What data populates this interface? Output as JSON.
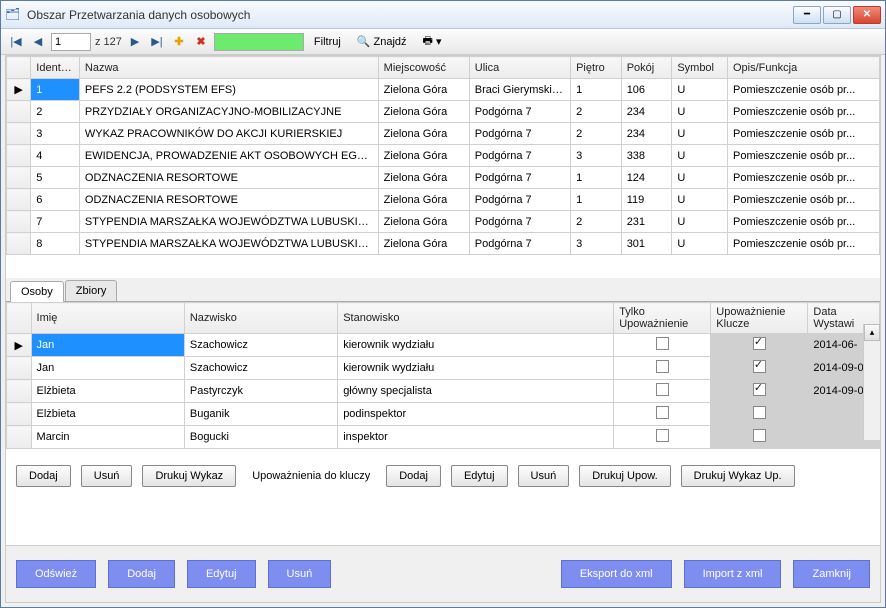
{
  "window": {
    "title": "Obszar Przetwarzania danych osobowych"
  },
  "toolbar": {
    "page_current": "1",
    "page_total": "z 127",
    "filter_label": "Filtruj",
    "find_label": "Znajdź"
  },
  "grid1": {
    "headers": {
      "ident": "Identyfik",
      "nazwa": "Nazwa",
      "miejsc": "Miejscowość",
      "ulica": "Ulica",
      "pietro": "Piętro",
      "pokoj": "Pokój",
      "symbol": "Symbol",
      "opis": "Opis/Funkcja"
    },
    "rows": [
      {
        "id": "1",
        "nazwa": "PEFS 2.2 (PODSYSTEM EFS)",
        "miejsc": "Zielona Góra",
        "ulica": "Braci Gierymskic...",
        "pietro": "1",
        "pokoj": "106",
        "symbol": "U",
        "opis": "Pomieszczenie osób pr..."
      },
      {
        "id": "2",
        "nazwa": "PRZYDZIAŁY ORGANIZACYJNO-MOBILIZACYJNE",
        "miejsc": "Zielona Góra",
        "ulica": "Podgórna 7",
        "pietro": "2",
        "pokoj": "234",
        "symbol": "U",
        "opis": "Pomieszczenie osób pr..."
      },
      {
        "id": "3",
        "nazwa": "WYKAZ PRACOWNIKÓW DO AKCJI KURIERSKIEJ",
        "miejsc": "Zielona Góra",
        "ulica": "Podgórna 7",
        "pietro": "2",
        "pokoj": "234",
        "symbol": "U",
        "opis": "Pomieszczenie osób pr..."
      },
      {
        "id": "4",
        "nazwa": "EWIDENCJA, PROWADZENIE AKT OSOBOWYCH EGZA...",
        "miejsc": "Zielona Góra",
        "ulica": "Podgórna 7",
        "pietro": "3",
        "pokoj": "338",
        "symbol": "U",
        "opis": "Pomieszczenie osób pr..."
      },
      {
        "id": "5",
        "nazwa": "ODZNACZENIA RESORTOWE",
        "miejsc": "Zielona Góra",
        "ulica": "Podgórna 7",
        "pietro": "1",
        "pokoj": "124",
        "symbol": "U",
        "opis": "Pomieszczenie osób pr..."
      },
      {
        "id": "6",
        "nazwa": "ODZNACZENIA RESORTOWE",
        "miejsc": "Zielona Góra",
        "ulica": "Podgórna 7",
        "pietro": "1",
        "pokoj": "119",
        "symbol": "U",
        "opis": "Pomieszczenie osób pr..."
      },
      {
        "id": "7",
        "nazwa": "STYPENDIA MARSZAŁKA WOJEWÓDZTWA LUBUSKIE...",
        "miejsc": "Zielona Góra",
        "ulica": "Podgórna 7",
        "pietro": "2",
        "pokoj": "231",
        "symbol": "U",
        "opis": "Pomieszczenie osób pr..."
      },
      {
        "id": "8",
        "nazwa": "STYPENDIA MARSZAŁKA WOJEWÓDZTWA LUBUSKIE...",
        "miejsc": "Zielona Góra",
        "ulica": "Podgórna 7",
        "pietro": "3",
        "pokoj": "301",
        "symbol": "U",
        "opis": "Pomieszczenie osób pr..."
      }
    ]
  },
  "tabs": {
    "osoby": "Osoby",
    "zbiory": "Zbiory"
  },
  "grid2": {
    "headers": {
      "imie": "Imię",
      "nazwisko": "Nazwisko",
      "stanowisko": "Stanowisko",
      "tylko": "Tylko Upoważnienie",
      "klucze": "Upoważnienie Klucze",
      "data": "Data Wystawi"
    },
    "rows": [
      {
        "imie": "Jan",
        "nazwisko": "Szachowicz",
        "stanowisko": "kierownik wydziału",
        "tylko": false,
        "klucze": true,
        "data": "2014-06-"
      },
      {
        "imie": "Jan",
        "nazwisko": "Szachowicz",
        "stanowisko": "kierownik wydziału",
        "tylko": false,
        "klucze": true,
        "data": "2014-09-0"
      },
      {
        "imie": "Elżbieta",
        "nazwisko": "Pastyrczyk",
        "stanowisko": "główny specjalista",
        "tylko": false,
        "klucze": true,
        "data": "2014-09-0"
      },
      {
        "imie": "Elżbieta",
        "nazwisko": "Buganik",
        "stanowisko": "podinspektor",
        "tylko": false,
        "klucze": false,
        "data": ""
      },
      {
        "imie": "Marcin",
        "nazwisko": "Bogucki",
        "stanowisko": "inspektor",
        "tylko": false,
        "klucze": false,
        "data": ""
      }
    ]
  },
  "btns1": {
    "dodaj": "Dodaj",
    "usun": "Usuń",
    "drukuj_wykaz": "Drukuj Wykaz",
    "upow_label": "Upoważnienia do kluczy",
    "dodaj2": "Dodaj",
    "edytuj": "Edytuj",
    "usun2": "Usuń",
    "drukuj_upow": "Drukuj Upow.",
    "drukuj_wykaz_up": "Drukuj Wykaz Up."
  },
  "footer": {
    "odswiez": "Odśwież",
    "dodaj": "Dodaj",
    "edytuj": "Edytuj",
    "usun": "Usuń",
    "eksport": "Eksport do xml",
    "import": "Import z xml",
    "zamknij": "Zamknij"
  }
}
